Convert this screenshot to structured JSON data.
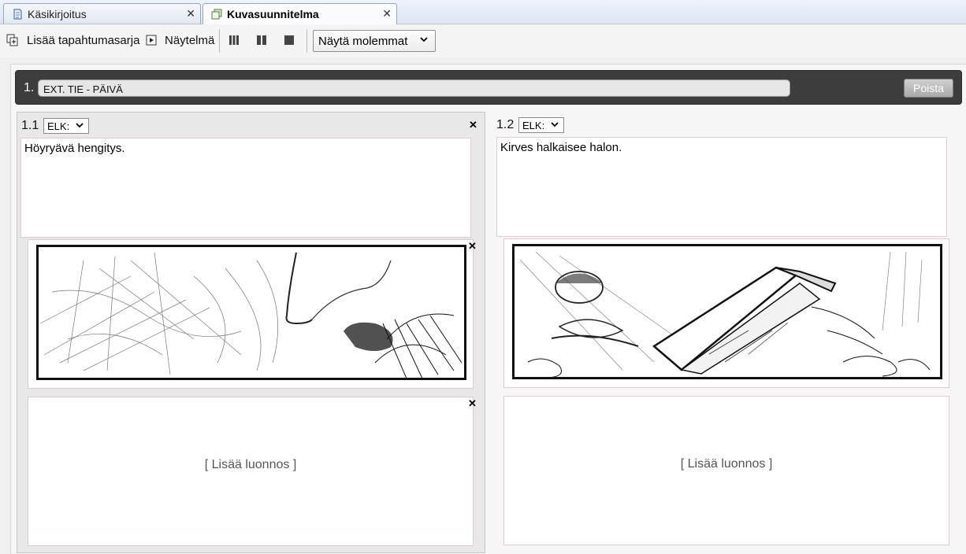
{
  "tabs": [
    {
      "label": "Käsikirjoitus",
      "icon": "document-icon",
      "active": false
    },
    {
      "label": "Kuvasuunnitelma",
      "icon": "storyboard-icon",
      "active": true
    }
  ],
  "toolbar": {
    "add_sequence": "Lisää tapahtumasarja",
    "play": "Näytelmä",
    "view_select": "Näytä molemmat"
  },
  "scene": {
    "number": "1.",
    "title": "EXT. TIE - PÄIVÄ",
    "delete": "Poista"
  },
  "shots": [
    {
      "number": "1.1",
      "shot_type": "ELK:",
      "description": "Höyryävä hengitys.",
      "sketch": "breath-sketch",
      "add_sketch": "[ Lisää luonnos ]"
    },
    {
      "number": "1.2",
      "shot_type": "ELK:",
      "description": "Kirves halkaisee halon.",
      "sketch": "axe-log-sketch",
      "add_sketch": "[ Lisää luonnos ]"
    }
  ]
}
